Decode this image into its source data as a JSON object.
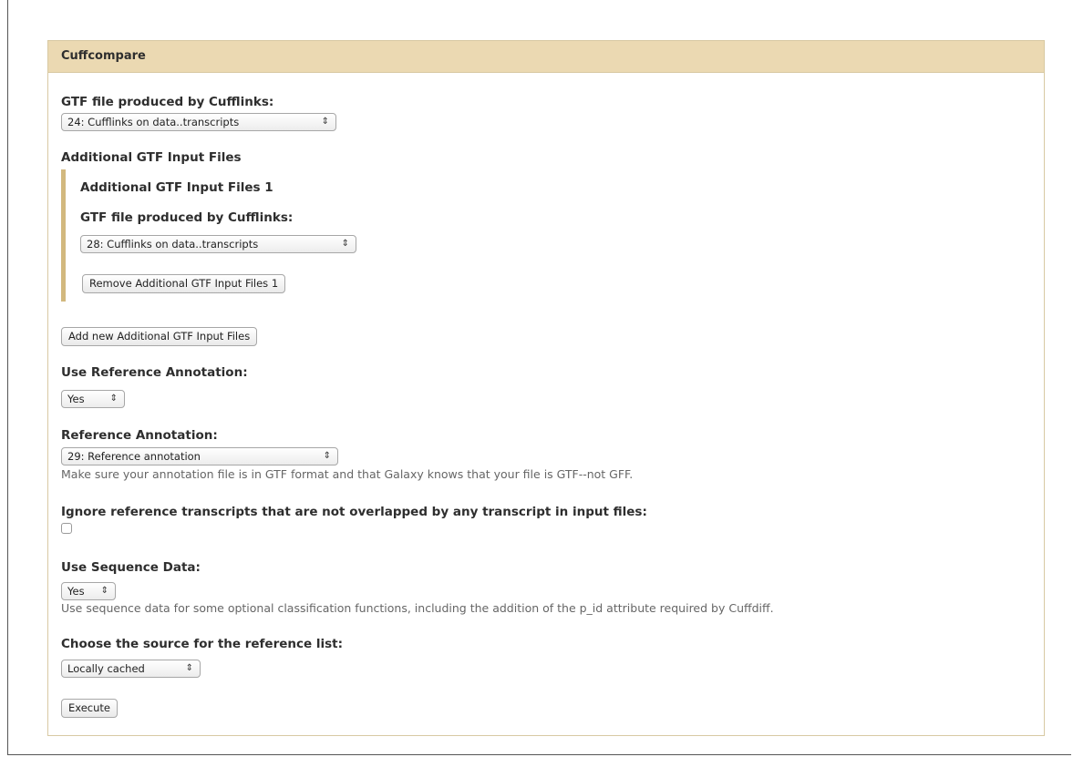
{
  "tool": {
    "title": "Cuffcompare"
  },
  "gtf_input": {
    "label": "GTF file produced by Cufflinks:",
    "selected": "24: Cufflinks on data..transcripts"
  },
  "additional": {
    "section_title": "Additional GTF Input Files",
    "item_title": "Additional GTF Input Files 1",
    "item_label": "GTF file produced by Cufflinks:",
    "item_selected": "28: Cufflinks on data..transcripts",
    "remove_label": "Remove Additional GTF Input Files 1",
    "add_label": "Add new Additional GTF Input Files"
  },
  "use_ref": {
    "label": "Use Reference Annotation:",
    "selected": "Yes"
  },
  "ref_annotation": {
    "label": "Reference Annotation:",
    "selected": "29: Reference annotation",
    "help": "Make sure your annotation file is in GTF format and that Galaxy knows that your file is GTF--not GFF."
  },
  "ignore_ref": {
    "label": "Ignore reference transcripts that are not overlapped by any transcript in input files:",
    "checked": false
  },
  "use_seq": {
    "label": "Use Sequence Data:",
    "selected": "Yes",
    "help": "Use sequence data for some optional classification functions, including the addition of the p_id attribute required by Cuffdiff."
  },
  "ref_source": {
    "label": "Choose the source for the reference list:",
    "selected": "Locally cached"
  },
  "execute_label": "Execute",
  "icons": {
    "select_arrow": "⇕"
  }
}
